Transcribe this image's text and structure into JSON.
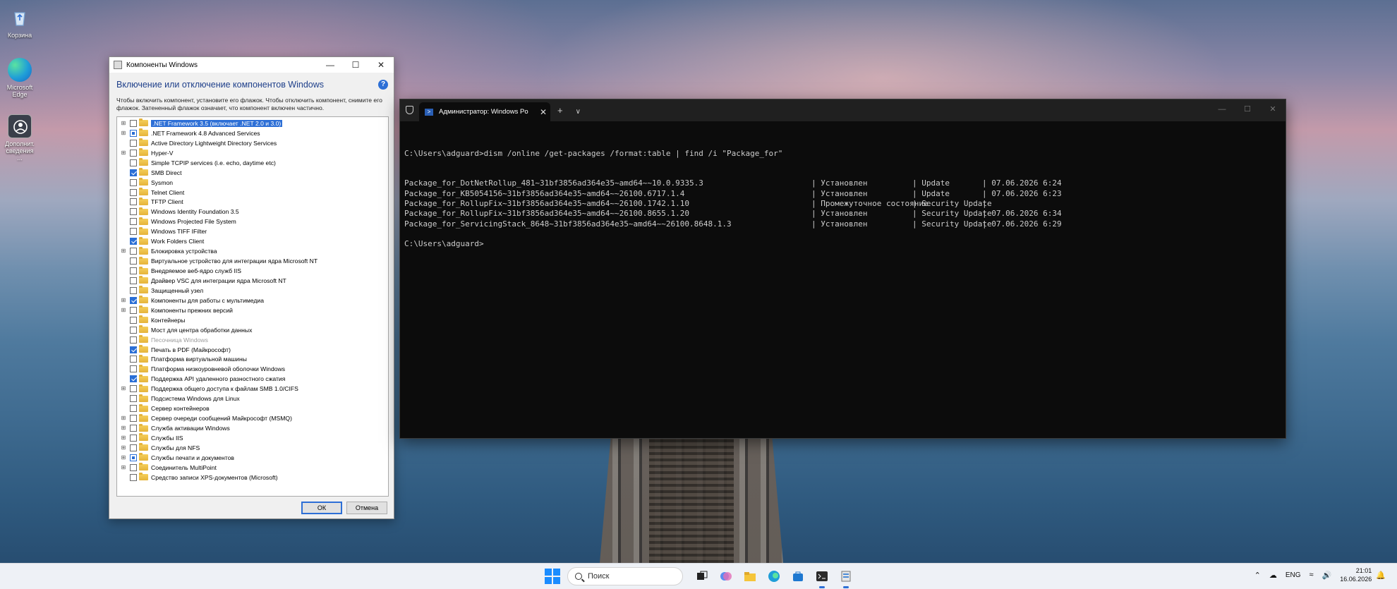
{
  "desktop": {
    "icons": [
      {
        "label": "Корзина",
        "icon": "recycle-bin-icon"
      },
      {
        "label": "Microsoft Edge",
        "icon": "edge-icon"
      },
      {
        "label": "Дополнит. сведения ...",
        "icon": "info-icon"
      }
    ]
  },
  "dialog": {
    "title": "Компоненты Windows",
    "heading": "Включение или отключение компонентов Windows",
    "description": "Чтобы включить компонент, установите его флажок. Чтобы отключить компонент, снимите его флажок. Затененный флажок означает, что компонент включен частично.",
    "ok_label": "ОК",
    "cancel_label": "Отмена",
    "features": [
      {
        "label": ".NET Framework 3.5 (включает .NET 2.0 и 3.0)",
        "state": "unchecked",
        "expandable": true,
        "selected": true
      },
      {
        "label": ".NET Framework 4.8 Advanced Services",
        "state": "partial",
        "expandable": true
      },
      {
        "label": "Active Directory Lightweight Directory Services",
        "state": "unchecked",
        "expandable": false
      },
      {
        "label": "Hyper-V",
        "state": "unchecked",
        "expandable": true
      },
      {
        "label": "Simple TCPIP services (i.e. echo, daytime etc)",
        "state": "unchecked",
        "expandable": false
      },
      {
        "label": "SMB Direct",
        "state": "checked",
        "expandable": false
      },
      {
        "label": "Sysmon",
        "state": "unchecked",
        "expandable": false
      },
      {
        "label": "Telnet Client",
        "state": "unchecked",
        "expandable": false
      },
      {
        "label": "TFTP Client",
        "state": "unchecked",
        "expandable": false
      },
      {
        "label": "Windows Identity Foundation 3.5",
        "state": "unchecked",
        "expandable": false
      },
      {
        "label": "Windows Projected File System",
        "state": "unchecked",
        "expandable": false
      },
      {
        "label": "Windows TIFF IFilter",
        "state": "unchecked",
        "expandable": false
      },
      {
        "label": "Work Folders Client",
        "state": "checked",
        "expandable": false
      },
      {
        "label": "Блокировка устройства",
        "state": "unchecked",
        "expandable": true
      },
      {
        "label": "Виртуальное устройство для интеграции ядра Microsoft NT",
        "state": "unchecked",
        "expandable": false
      },
      {
        "label": "Внедряемое веб-ядро служб IIS",
        "state": "unchecked",
        "expandable": false
      },
      {
        "label": "Драйвер VSC для интеграции ядра Microsoft NT",
        "state": "unchecked",
        "expandable": false
      },
      {
        "label": "Защищенный узел",
        "state": "unchecked",
        "expandable": false
      },
      {
        "label": "Компоненты для работы с мультимедиа",
        "state": "checked",
        "expandable": true
      },
      {
        "label": "Компоненты прежних версий",
        "state": "unchecked",
        "expandable": true
      },
      {
        "label": "Контейнеры",
        "state": "unchecked",
        "expandable": false
      },
      {
        "label": "Мост для центра обработки данных",
        "state": "unchecked",
        "expandable": false
      },
      {
        "label": "Песочница Windows",
        "state": "unchecked",
        "expandable": false,
        "disabled": true
      },
      {
        "label": "Печать в PDF (Майкрософт)",
        "state": "checked",
        "expandable": false
      },
      {
        "label": "Платформа виртуальной машины",
        "state": "unchecked",
        "expandable": false
      },
      {
        "label": "Платформа низкоуровневой оболочки Windows",
        "state": "unchecked",
        "expandable": false
      },
      {
        "label": "Поддержка API удаленного разностного сжатия",
        "state": "checked",
        "expandable": false
      },
      {
        "label": "Поддержка общего доступа к файлам SMB 1.0/CIFS",
        "state": "unchecked",
        "expandable": true
      },
      {
        "label": "Подсистема Windows для Linux",
        "state": "unchecked",
        "expandable": false
      },
      {
        "label": "Сервер контейнеров",
        "state": "unchecked",
        "expandable": false
      },
      {
        "label": "Сервер очереди сообщений Майкрософт (MSMQ)",
        "state": "unchecked",
        "expandable": true
      },
      {
        "label": "Служба активации Windows",
        "state": "unchecked",
        "expandable": true
      },
      {
        "label": "Службы IIS",
        "state": "unchecked",
        "expandable": true
      },
      {
        "label": "Службы для NFS",
        "state": "unchecked",
        "expandable": true
      },
      {
        "label": "Службы печати и документов",
        "state": "partial",
        "expandable": true
      },
      {
        "label": "Соединитель MultiPoint",
        "state": "unchecked",
        "expandable": true
      },
      {
        "label": "Средство записи XPS-документов (Microsoft)",
        "state": "unchecked",
        "expandable": false
      }
    ]
  },
  "terminal": {
    "tab_title": "Администратор: Windows Po",
    "command_line": "C:\\Users\\adguard>dism /online /get-packages /format:table | find /i \"Package_for\"",
    "rows": [
      {
        "name": "Package_for_DotNetRollup_481~31bf3856ad364e35~amd64~~10.0.9335.3",
        "state": "| Установлен",
        "type": "| Update",
        "date": "| 07.06.2026 6:24"
      },
      {
        "name": "Package_for_KB5054156~31bf3856ad364e35~amd64~~26100.6717.1.4",
        "state": "| Установлен",
        "type": "| Update",
        "date": "| 07.06.2026 6:23"
      },
      {
        "name": "Package_for_RollupFix~31bf3856ad364e35~amd64~~26100.1742.1.10",
        "state": "| Промежуточное состояние",
        "type": "| Security Update",
        "date": "|"
      },
      {
        "name": "Package_for_RollupFix~31bf3856ad364e35~amd64~~26100.8655.1.20",
        "state": "| Установлен",
        "type": "| Security Update",
        "date": "| 07.06.2026 6:34"
      },
      {
        "name": "Package_for_ServicingStack_8648~31bf3856ad364e35~amd64~~26100.8648.1.3",
        "state": "| Установлен",
        "type": "| Security Update",
        "date": "| 07.06.2026 6:29"
      }
    ],
    "prompt": "C:\\Users\\adguard>"
  },
  "taskbar": {
    "search_placeholder": "Поиск",
    "language": "ENG",
    "time": "21:01",
    "date": "16.06.2026",
    "accent": "#2d6fd6"
  }
}
